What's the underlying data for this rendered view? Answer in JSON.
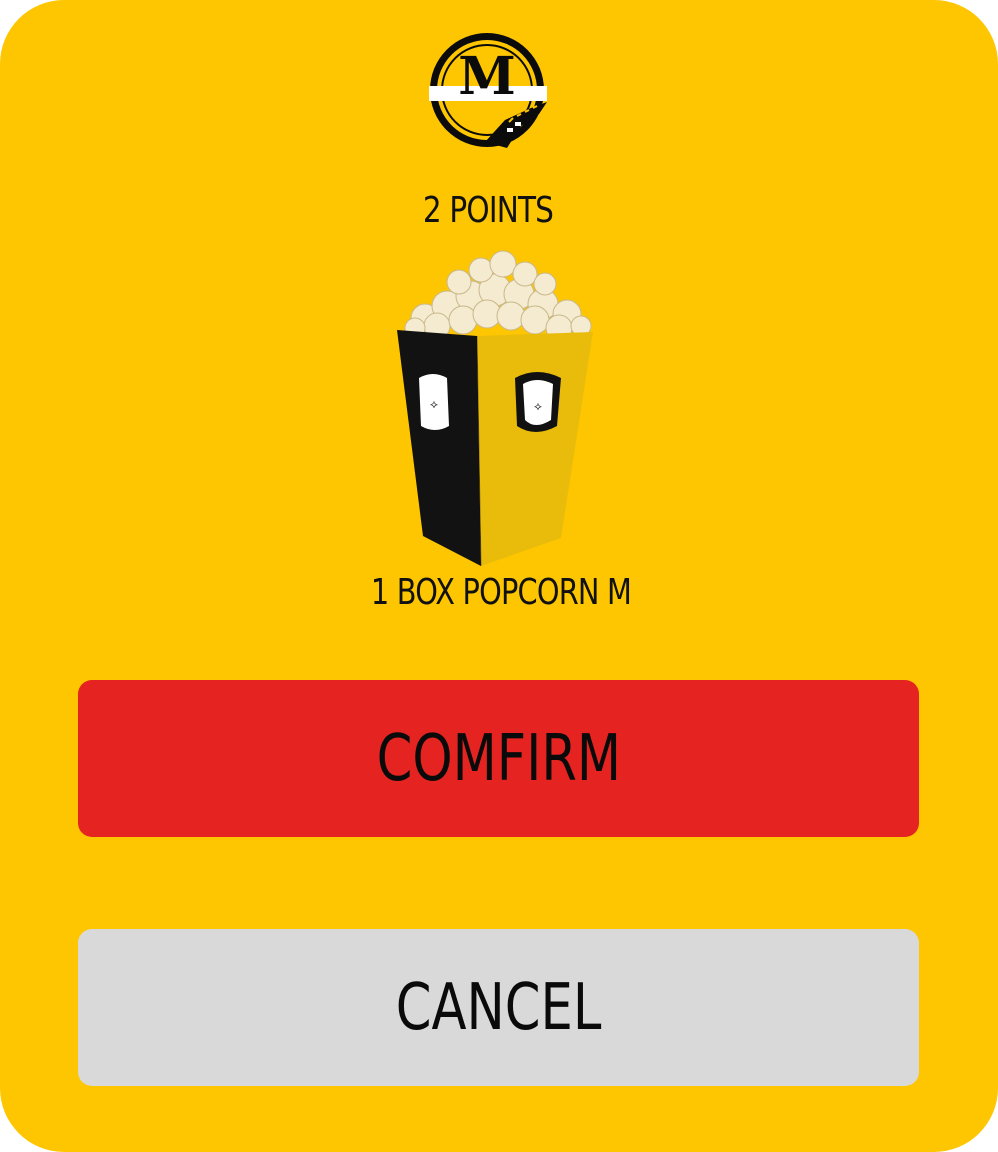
{
  "dialog": {
    "logo": {
      "letter": "M",
      "icon": "film-reel-logo-icon"
    },
    "points_label": "2 POINTS",
    "product": {
      "name": "1 BOX POPCORN M",
      "image_icon": "popcorn-box-image"
    },
    "confirm_label": "COMFIRM",
    "cancel_label": "CANCEL"
  },
  "colors": {
    "background": "#FEC600",
    "confirm": "#E52421",
    "cancel": "#D9D9D9",
    "text": "#111111"
  }
}
